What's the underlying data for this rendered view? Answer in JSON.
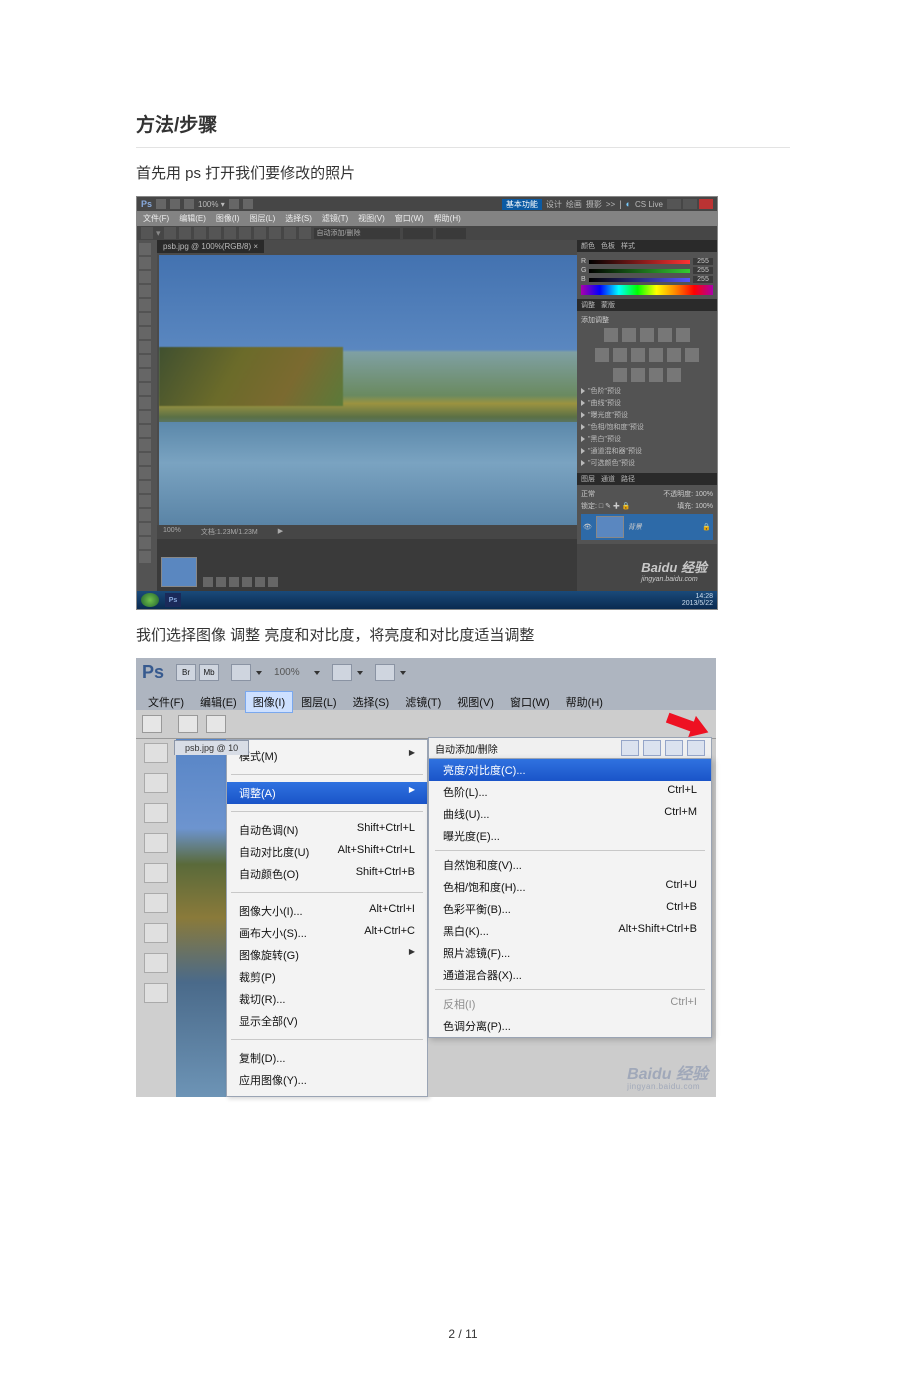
{
  "heading": "方法/步骤",
  "step1": "首先用 ps 打开我们要修改的照片",
  "step2": "我们选择图像  调整  亮度和对比度，将亮度和对比度适当调整",
  "page_number_text": "2  /  11",
  "shot1": {
    "topbar": {
      "basic_label": "基本功能",
      "right_items": [
        "设计",
        "绘画",
        "摄影",
        ">>"
      ],
      "cslive": "CS Live"
    },
    "menubar": [
      "文件(F)",
      "编辑(E)",
      "图像(I)",
      "图层(L)",
      "选择(S)",
      "滤镜(T)",
      "视图(V)",
      "窗口(W)",
      "帮助(H)"
    ],
    "optionbar": {
      "label": "自动添加/删除"
    },
    "tab_title": "psb.jpg @ 100%(RGB/8) ×",
    "status": {
      "zoom": "100%",
      "docinfo": "文档:1.23M/1.23M"
    },
    "color_panel": {
      "tabs": [
        "颜色",
        "色板",
        "样式"
      ],
      "r": "255",
      "g": "255",
      "b": "255"
    },
    "adjust_panel": {
      "tabs": [
        "调整",
        "蒙版"
      ],
      "title": "添加调整",
      "presets": [
        "\"色阶\"预设",
        "\"曲线\"预设",
        "\"曝光度\"预设",
        "\"色相/饱和度\"预设",
        "\"黑白\"预设",
        "\"通道混和器\"预设",
        "\"可选颜色\"预设"
      ]
    },
    "layer_panel": {
      "tabs": [
        "图层",
        "通道",
        "路径"
      ],
      "mode": "正常",
      "opacity_label": "不透明度:",
      "opacity": "100%",
      "lock_label": "锁定:",
      "fill_label": "填充:",
      "fill": "100%",
      "layer_name": "背景"
    },
    "watermark": {
      "brand": "Baidu 经验",
      "url": "jingyan.baidu.com"
    },
    "taskbar": {
      "ps": "Ps",
      "time": "14:28",
      "date": "2013/5/22"
    }
  },
  "shot2": {
    "ps_logo": "Ps",
    "launchers": [
      "Br",
      "Mb"
    ],
    "zoom_text": "100%",
    "menubar": [
      "文件(F)",
      "编辑(E)",
      "图像(I)",
      "图层(L)",
      "选择(S)",
      "滤镜(T)",
      "视图(V)",
      "窗口(W)",
      "帮助(H)"
    ],
    "tab_title": "psb.jpg @ 10",
    "image_menu": {
      "mode": "模式(M)",
      "adjust": "调整(A)",
      "auto": [
        {
          "label": "自动色调(N)",
          "shortcut": "Shift+Ctrl+L"
        },
        {
          "label": "自动对比度(U)",
          "shortcut": "Alt+Shift+Ctrl+L"
        },
        {
          "label": "自动颜色(O)",
          "shortcut": "Shift+Ctrl+B"
        }
      ],
      "size": [
        {
          "label": "图像大小(I)...",
          "shortcut": "Alt+Ctrl+I"
        },
        {
          "label": "画布大小(S)...",
          "shortcut": "Alt+Ctrl+C"
        },
        {
          "label": "图像旋转(G)",
          "shortcut": ""
        },
        {
          "label": "裁剪(P)",
          "shortcut": ""
        },
        {
          "label": "裁切(R)...",
          "shortcut": ""
        },
        {
          "label": "显示全部(V)",
          "shortcut": ""
        }
      ],
      "dup": [
        {
          "label": "复制(D)...",
          "shortcut": ""
        },
        {
          "label": "应用图像(Y)...",
          "shortcut": ""
        }
      ]
    },
    "auto_header": "自动添加/删除",
    "adjust_menu": {
      "hi": "亮度/对比度(C)...",
      "g1": [
        {
          "label": "色阶(L)...",
          "shortcut": "Ctrl+L"
        },
        {
          "label": "曲线(U)...",
          "shortcut": "Ctrl+M"
        },
        {
          "label": "曝光度(E)...",
          "shortcut": ""
        }
      ],
      "g2": [
        {
          "label": "自然饱和度(V)...",
          "shortcut": ""
        },
        {
          "label": "色相/饱和度(H)...",
          "shortcut": "Ctrl+U"
        },
        {
          "label": "色彩平衡(B)...",
          "shortcut": "Ctrl+B"
        },
        {
          "label": "黑白(K)...",
          "shortcut": "Alt+Shift+Ctrl+B"
        },
        {
          "label": "照片滤镜(F)...",
          "shortcut": ""
        },
        {
          "label": "通道混合器(X)...",
          "shortcut": ""
        }
      ],
      "g3": [
        {
          "label": "反相(I)",
          "shortcut": "Ctrl+I"
        },
        {
          "label": "色调分离(P)...",
          "shortcut": ""
        }
      ]
    },
    "watermark": {
      "brand": "Baidu 经验",
      "url": "jingyan.baidu.com"
    }
  }
}
